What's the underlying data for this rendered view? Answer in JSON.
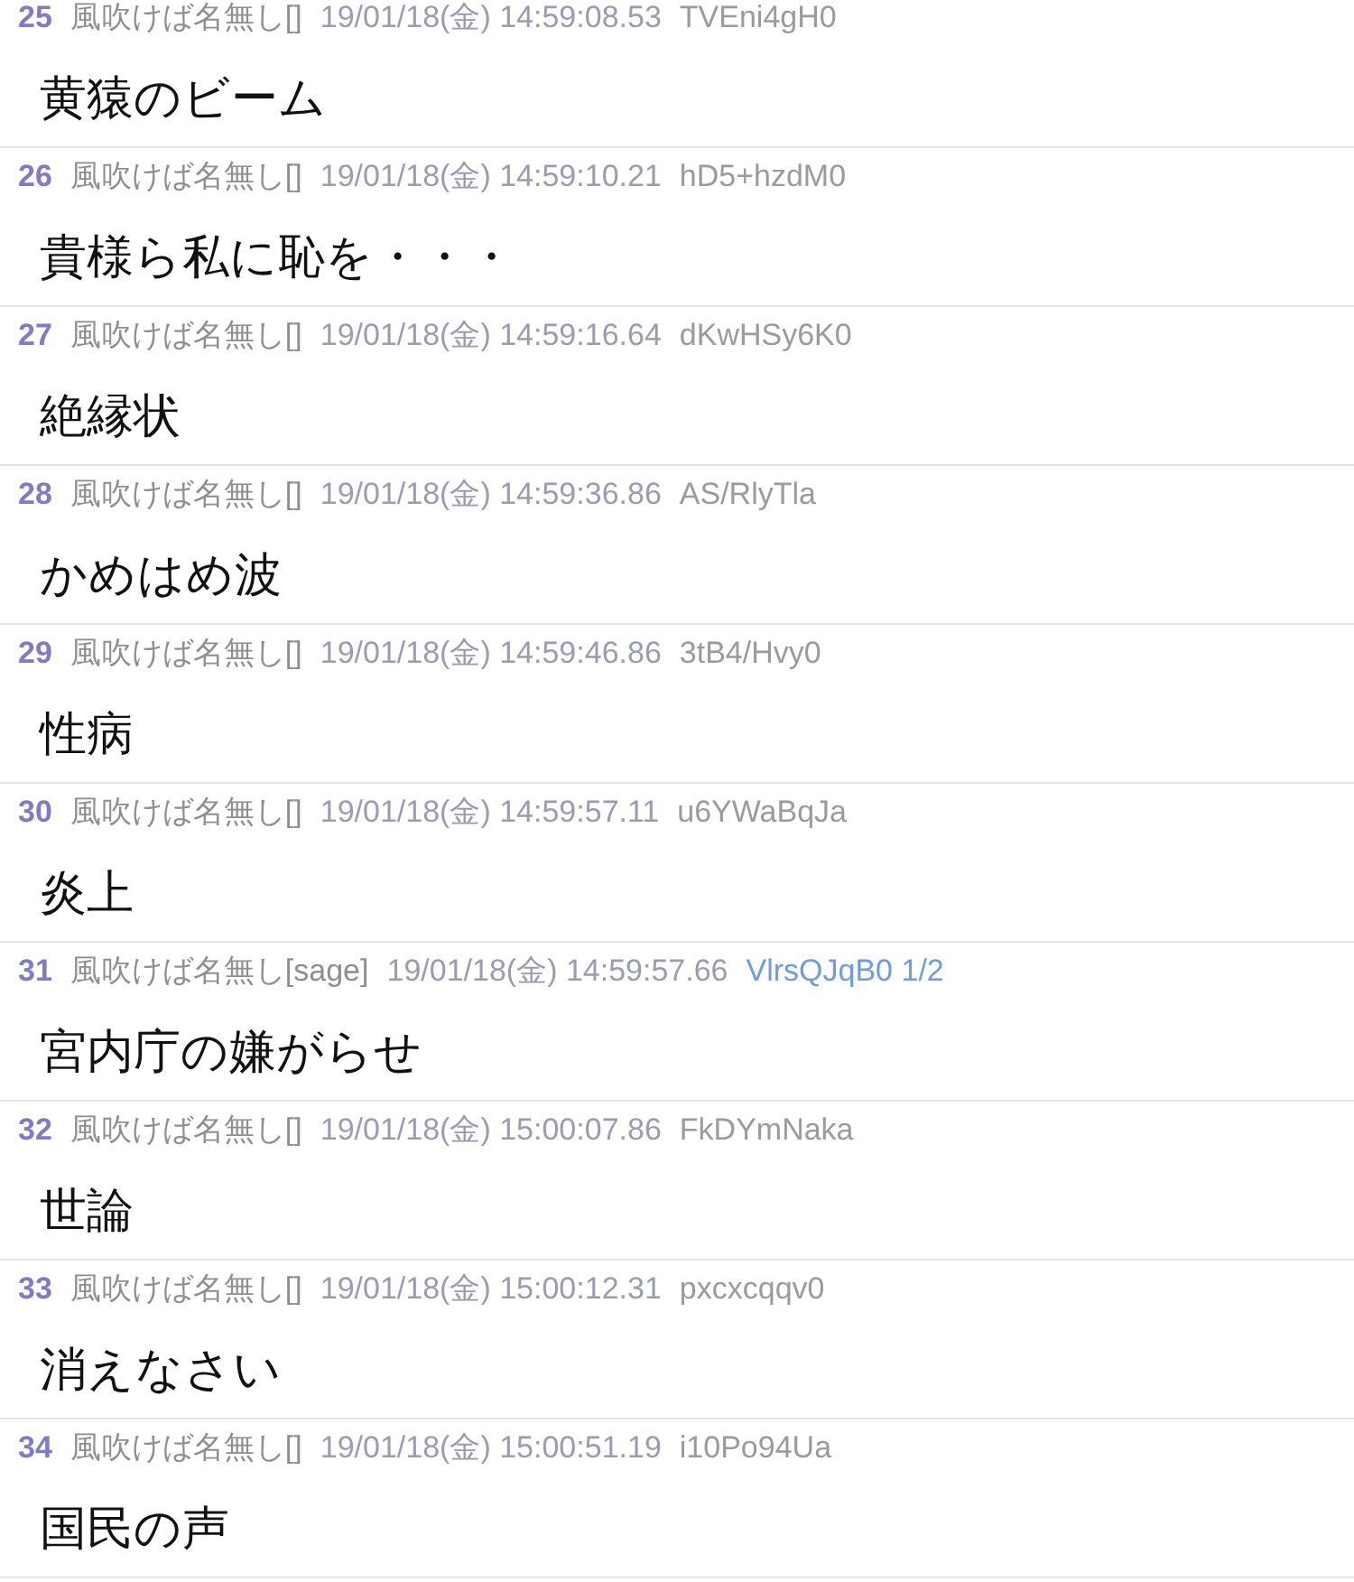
{
  "posts": [
    {
      "number": "25",
      "name": "風吹けば名無し[]",
      "date": "19/01/18(金) 14:59:08.53",
      "id": "TVEni4gH0",
      "id_highlighted": false,
      "body": "黄猿のビーム"
    },
    {
      "number": "26",
      "name": "風吹けば名無し[]",
      "date": "19/01/18(金) 14:59:10.21",
      "id": "hD5+hzdM0",
      "id_highlighted": false,
      "body": "貴様ら私に恥を・・・"
    },
    {
      "number": "27",
      "name": "風吹けば名無し[]",
      "date": "19/01/18(金) 14:59:16.64",
      "id": "dKwHSy6K0",
      "id_highlighted": false,
      "body": "絶縁状"
    },
    {
      "number": "28",
      "name": "風吹けば名無し[]",
      "date": "19/01/18(金) 14:59:36.86",
      "id": "AS/RlyTla",
      "id_highlighted": false,
      "body": "かめはめ波"
    },
    {
      "number": "29",
      "name": "風吹けば名無し[]",
      "date": "19/01/18(金) 14:59:46.86",
      "id": "3tB4/Hvy0",
      "id_highlighted": false,
      "body": "性病"
    },
    {
      "number": "30",
      "name": "風吹けば名無し[]",
      "date": "19/01/18(金) 14:59:57.11",
      "id": "u6YWaBqJa",
      "id_highlighted": false,
      "body": "炎上"
    },
    {
      "number": "31",
      "name": "風吹けば名無し[sage]",
      "date": "19/01/18(金) 14:59:57.66",
      "id": "VlrsQJqB0 1/2",
      "id_highlighted": true,
      "body": "宮内庁の嫌がらせ"
    },
    {
      "number": "32",
      "name": "風吹けば名無し[]",
      "date": "19/01/18(金) 15:00:07.86",
      "id": "FkDYmNaka",
      "id_highlighted": false,
      "body": "世論"
    },
    {
      "number": "33",
      "name": "風吹けば名無し[]",
      "date": "19/01/18(金) 15:00:12.31",
      "id": "pxcxcqqv0",
      "id_highlighted": false,
      "body": "消えなさい"
    },
    {
      "number": "34",
      "name": "風吹けば名無し[]",
      "date": "19/01/18(金) 15:00:51.19",
      "id": "i10Po94Ua",
      "id_highlighted": false,
      "body": "国民の声"
    }
  ]
}
